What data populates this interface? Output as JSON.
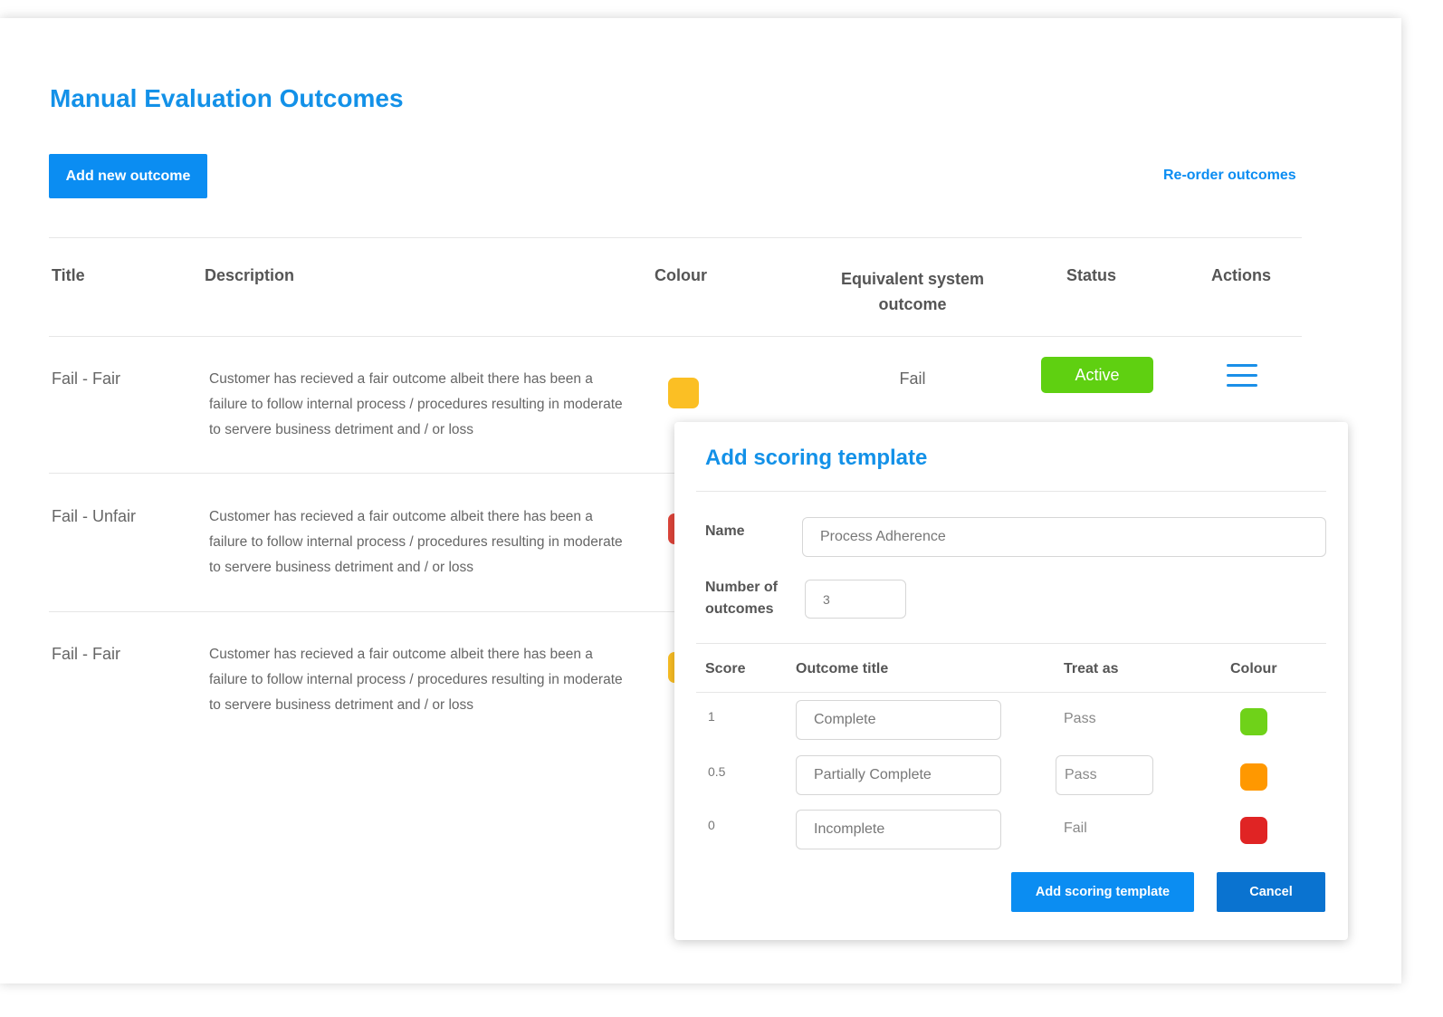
{
  "page": {
    "title": "Manual Evaluation Outcomes",
    "add_button": "Add new outcome",
    "reorder_link": "Re-order outcomes"
  },
  "table": {
    "headers": {
      "title": "Title",
      "description": "Description",
      "colour": "Colour",
      "system_outcome_line1": "Equivalent system",
      "system_outcome_line2": "outcome",
      "status": "Status",
      "actions": "Actions"
    },
    "rows": [
      {
        "title": "Fail - Fair",
        "description": "Customer has recieved a fair outcome albeit there has been a failure to follow internal process / procedures resulting in moderate to servere business detriment and / or loss",
        "colour": "#fbbf24",
        "system_outcome": "Fail",
        "status": "Active"
      },
      {
        "title": "Fail - Unfair",
        "description": "Customer has recieved a fair outcome albeit there has been a failure to follow internal process / procedures resulting in moderate to servere business detriment and / or loss",
        "colour": "#e0453a"
      },
      {
        "title": "Fail - Fair",
        "description": "Customer has recieved a fair outcome albeit there has been a failure to follow internal process / procedures resulting in moderate to servere business detriment and / or loss",
        "colour": "#fbbf24"
      }
    ]
  },
  "modal": {
    "title": "Add scoring template",
    "name_label": "Name",
    "name_value": "Process Adherence",
    "count_label_line1": "Number of",
    "count_label_line2": "outcomes",
    "count_value": "3",
    "columns": {
      "score": "Score",
      "outcome_title": "Outcome title",
      "treat_as": "Treat as",
      "colour": "Colour"
    },
    "outcomes": [
      {
        "score": "1",
        "title": "Complete",
        "treat_as": "Pass",
        "colour": "#6fd219"
      },
      {
        "score": "0.5",
        "title": "Partially Complete",
        "treat_as": "Pass",
        "colour": "#ff9800"
      },
      {
        "score": "0",
        "title": "Incomplete",
        "treat_as": "Fail",
        "colour": "#e02424"
      }
    ],
    "submit_button": "Add scoring template",
    "cancel_button": "Cancel"
  },
  "colors": {
    "accent": "#0b8df2",
    "title_blue": "#1391e8",
    "cancel_blue": "#0a73d0",
    "active_green": "#5fd011"
  },
  "icons": {
    "row_action": "hamburger-menu-icon"
  }
}
